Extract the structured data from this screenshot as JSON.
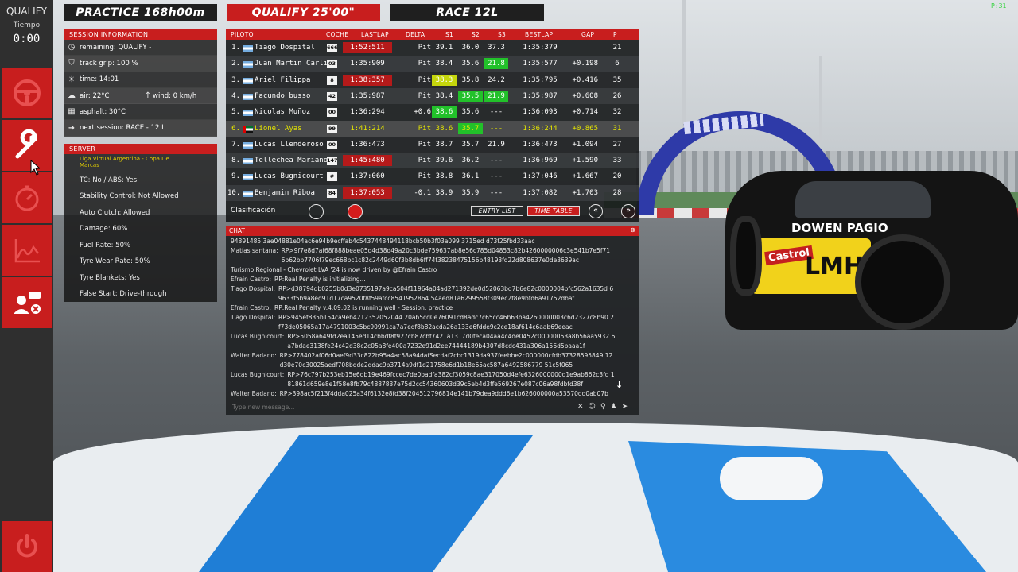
{
  "sidebar": {
    "mode": "QUALIFY",
    "time_label": "Tiempo",
    "clock": "0:00",
    "buttons": [
      "steering-wheel",
      "wrench",
      "stopwatch",
      "telemetry-graph",
      "driver-settings"
    ],
    "power": "power"
  },
  "tabs": {
    "practice": "PRACTICE 168h00m",
    "qualify": "QUALIFY 25'00\"",
    "race": "RACE 12L"
  },
  "session_info": {
    "title": "SESSION INFORMATION",
    "remaining": "remaining: QUALIFY -",
    "track_grip": "track grip: 100 %",
    "time": "time: 14:01",
    "air": "air: 22°C",
    "wind": "wind: 0 km/h",
    "asphalt": "asphalt: 30°C",
    "next_session": "next session: RACE - 12 L"
  },
  "server": {
    "title": "SERVER",
    "name": "Liga Virtual Argentina - Copa De Marcas",
    "rows": [
      "TC: No / ABS: Yes",
      "Stability Control: Not Allowed",
      "Auto Clutch: Allowed",
      "Damage: 60%",
      "Fuel Rate: 50%",
      "Tyre Wear Rate: 50%",
      "Tyre Blankets: Yes",
      "False Start: Drive-through"
    ]
  },
  "timing": {
    "headers": {
      "piloto": "PILOTO",
      "coche": "COCHE",
      "lastlap": "LASTLAP",
      "delta": "DELTA",
      "s1": "S1",
      "s2": "S2",
      "s3": "S3",
      "bestlap": "BESTLAP",
      "gap": "GAP",
      "p": "P"
    },
    "rows": [
      {
        "pos": "1.",
        "name": "Tiago Dospital",
        "car": "666",
        "last": "1:52:511",
        "delta": "Pit",
        "s1": "39.1",
        "s2": "36.0",
        "s3": "37.3",
        "best": "1:35:379",
        "gap": "",
        "p": "21"
      },
      {
        "pos": "2.",
        "name": "Juan Martin Carli",
        "car": "03",
        "last": "1:35:909",
        "delta": "Pit",
        "s1": "38.4",
        "s2": "35.6",
        "s3": "21.8",
        "best": "1:35:577",
        "gap": "+0.198",
        "p": "6"
      },
      {
        "pos": "3.",
        "name": "Ariel Filippa",
        "car": "8",
        "last": "1:38:357",
        "delta": "Pit",
        "s1": "38.3",
        "s2": "35.8",
        "s3": "24.2",
        "best": "1:35:795",
        "gap": "+0.416",
        "p": "35"
      },
      {
        "pos": "4.",
        "name": "Facundo busso",
        "car": "42",
        "last": "1:35:987",
        "delta": "Pit",
        "s1": "38.4",
        "s2": "35.5",
        "s3": "21.9",
        "best": "1:35:987",
        "gap": "+0.608",
        "p": "26"
      },
      {
        "pos": "5.",
        "name": "Nicolas Muñoz",
        "car": "00",
        "last": "1:36:294",
        "delta": "+0.6",
        "s1": "38.6",
        "s2": "35.6",
        "s3": "---",
        "best": "1:36:093",
        "gap": "+0.714",
        "p": "32"
      },
      {
        "pos": "6.",
        "name": "Lionel Ayas",
        "car": "99",
        "last": "1:41:214",
        "delta": "Pit",
        "s1": "38.6",
        "s2": "35.7",
        "s3": "---",
        "best": "1:36:244",
        "gap": "+0.865",
        "p": "31"
      },
      {
        "pos": "7.",
        "name": "Lucas Llenderoso",
        "car": "00",
        "last": "1:36:473",
        "delta": "Pit",
        "s1": "38.7",
        "s2": "35.7",
        "s3": "21.9",
        "best": "1:36:473",
        "gap": "+1.094",
        "p": "27"
      },
      {
        "pos": "8.",
        "name": "Tellechea Mariano",
        "car": "147",
        "last": "1:45:480",
        "delta": "Pit",
        "s1": "39.6",
        "s2": "36.2",
        "s3": "---",
        "best": "1:36:969",
        "gap": "+1.590",
        "p": "33"
      },
      {
        "pos": "9.",
        "name": "Lucas Bugnicourt",
        "car": "#",
        "last": "1:37:060",
        "delta": "Pit",
        "s1": "38.8",
        "s2": "36.1",
        "s3": "---",
        "best": "1:37:046",
        "gap": "+1.667",
        "p": "20"
      },
      {
        "pos": "10.",
        "name": "Benjamin Riboa",
        "car": "84",
        "last": "1:37:053",
        "delta": "-0.1",
        "s1": "38.9",
        "s2": "35.9",
        "s3": "---",
        "best": "1:37:082",
        "gap": "+1.703",
        "p": "28"
      }
    ],
    "footer": {
      "label": "Clasificación",
      "entry_list": "ENTRY LIST",
      "time_table": "TIME TABLE",
      "prev": "«",
      "next": "»"
    }
  },
  "chat": {
    "title": "CHAT",
    "messages": [
      {
        "who": "",
        "text": "94891485 3ae04881e04ac6e94b9ecffab4c5437448494118bcb50b3f03a099 3715ed d73f25fbd33aac"
      },
      {
        "who": "Matías santana:",
        "text": "RP>9f7e8d7af68f888beae05d4d38d49a20c3bde759637ab8e56c785d04853c82b4260000006c3e541b7e5f71 6b62bb7706f79ec668bc1c82c2449d60f3b8db6ff74f38238475156b48193fd22d808637e0de3639ac"
      },
      {
        "who": "",
        "text": "Turismo Regional - Chevrolet LVA '24 is now driven by @Efrain Castro"
      },
      {
        "who": "Efrain Castro:",
        "text": "RP:Real Penalty is initializing..."
      },
      {
        "who": "Tiago Dospital:",
        "text": "RP>d38794db0255b0d3e0735197a9ca504f11964a04ad271392de0d52063bd7b6e82c0000004bfc562a1635d 69633f5b9a8ed91d17ca9520f8f59afcc8541952864 54aed81a6299558f309ec2f8e9bfd6a91752dbaf"
      },
      {
        "who": "Efrain Castro:",
        "text": "RP:Real Penalty v.4.09.02 is running well - Session: practice"
      },
      {
        "who": "Tiago Dospital:",
        "text": "RP>945ef835b154ca9eb4212352052044 20ab5cd0e76091cd8adc7c65cc46b63ba4260000003c6d2327c8b90 2f73de05065a17a4791003c5bc90991ca7a7edf8b82acda26a133e6fdde9c2ce18af614c6aab69eeac"
      },
      {
        "who": "Lucas Bugnicourt:",
        "text": "RP>5058a649fd2ea145ed14cbbdf8f927cb87cbf7421a1317d0feca04aa4c4de0452c00000053a8b56aa5932 6a7bdae3138fe24c42d38c2c05a8fe400a7232e91d2ee74444189b4307d8cdc431a306a156d5baaa1f"
      },
      {
        "who": "Walter Badano:",
        "text": "RP>778402af06d0aef9d33c822b95a4ac58a94dafSecdaf2cbc1319da937feebbe2c000000cfdb37328595849 12d30e70c30025aedf708bdde2ddac9b3714a9df1d21758e6d1b18e65ac587a6492586779 51c5f065"
      },
      {
        "who": "Lucas Bugnicourt:",
        "text": "RP>76c797b253eb15e6db19e469fccec7de0badfa382cf3059c8ae317050d4efe6326000000d1e9ab862c3fd 181861d659e8e1f58e8fb79c4887837e75d2cc54360603d39c5eb4d3ffe569267e087c06a98fdbfd38f"
      },
      {
        "who": "Walter Badano:",
        "text": "RP>398ac5f213f4dda025a34f6132e8fd38f204512796814e141b79dea9ddd6e1b626000000a53570dd0ab07b"
      }
    ],
    "input_placeholder": "Type new message..."
  },
  "hud": {
    "fps": "P:31"
  },
  "scene": {
    "rival_brand": "DOWEN PAGIO",
    "rival_sponsor": "Castrol",
    "rival_logo": "LMH"
  },
  "colors": {
    "accent_red": "#c81e1e",
    "sector_green": "#22c12a",
    "sector_yellow": "#c5d60c",
    "highlight_text": "#e6e600"
  }
}
